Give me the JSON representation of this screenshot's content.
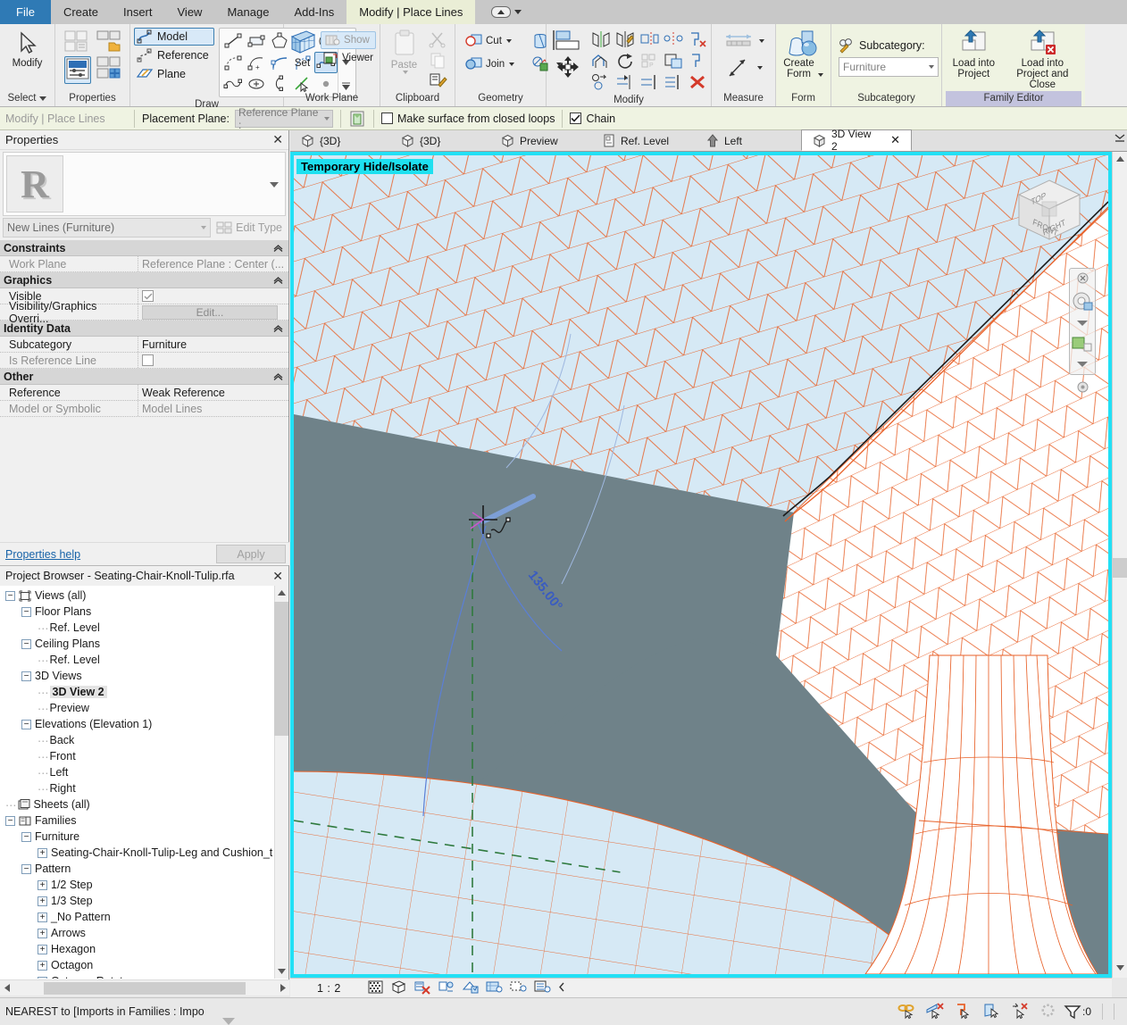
{
  "app": {
    "menu_tabs": [
      {
        "label": "File",
        "state": "file"
      },
      {
        "label": "Create",
        "state": "normal"
      },
      {
        "label": "Insert",
        "state": "normal"
      },
      {
        "label": "View",
        "state": "normal"
      },
      {
        "label": "Manage",
        "state": "normal"
      },
      {
        "label": "Add-Ins",
        "state": "normal"
      },
      {
        "label": "Modify | Place Lines",
        "state": "active"
      }
    ]
  },
  "ribbon": {
    "select_panel": {
      "title": "Select",
      "modify_label": "Modify"
    },
    "properties_panel": {
      "title": "Properties"
    },
    "draw_panel": {
      "title": "Draw",
      "model_label": "Model",
      "reference_label": "Reference",
      "plane_label": "Plane"
    },
    "workplane_panel": {
      "title": "Work Plane",
      "set_label": "Set",
      "show_label": "Show",
      "viewer_label": "Viewer"
    },
    "clipboard_panel": {
      "title": "Clipboard",
      "paste_label": "Paste"
    },
    "geometry_panel": {
      "title": "Geometry",
      "cut_label": "Cut",
      "join_label": "Join"
    },
    "modify_panel": {
      "title": "Modify"
    },
    "measure_panel": {
      "title": "Measure"
    },
    "form_panel": {
      "title": "Form",
      "create_form_label": "Create\nForm",
      "create_form_line1": "Create",
      "create_form_line2": "Form"
    },
    "subcategory_panel": {
      "title": "Subcategory",
      "label": "Subcategory:",
      "value": "Furniture"
    },
    "family_editor_panel": {
      "title": "Family Editor",
      "load_into_project_line1": "Load into",
      "load_into_project_line2": "Project",
      "load_close_line1": "Load into",
      "load_close_line2": "Project and Close"
    }
  },
  "options_bar": {
    "context": "Modify | Place Lines",
    "placement_plane_label": "Placement Plane:",
    "placement_plane_value": "Reference Plane :",
    "make_surface_label": "Make surface from closed loops",
    "make_surface_checked": false,
    "chain_label": "Chain",
    "chain_checked": true
  },
  "properties": {
    "title": "Properties",
    "thumbnail_letter": "R",
    "type_value": "New Lines (Furniture)",
    "edit_type_label": "Edit Type",
    "help_link": "Properties help",
    "apply_label": "Apply",
    "groups": [
      {
        "name": "Constraints",
        "rows": [
          {
            "name": "Work Plane",
            "value": "Reference Plane : Center (...",
            "kind": "text",
            "dim": true
          }
        ]
      },
      {
        "name": "Graphics",
        "rows": [
          {
            "name": "Visible",
            "value": "",
            "kind": "checkbox-checked",
            "dim": false
          },
          {
            "name": "Visibility/Graphics Overri...",
            "value": "Edit...",
            "kind": "button",
            "dim": false
          }
        ]
      },
      {
        "name": "Identity Data",
        "rows": [
          {
            "name": "Subcategory",
            "value": "Furniture",
            "kind": "text",
            "dim": false
          },
          {
            "name": "Is Reference Line",
            "value": "",
            "kind": "checkbox-empty",
            "dim": true
          }
        ]
      },
      {
        "name": "Other",
        "rows": [
          {
            "name": "Reference",
            "value": "Weak Reference",
            "kind": "text",
            "dim": false
          },
          {
            "name": "Model or Symbolic",
            "value": "Model Lines",
            "kind": "text",
            "dim": true
          }
        ]
      }
    ]
  },
  "browser": {
    "title": "Project Browser - Seating-Chair-Knoll-Tulip.rfa",
    "nodes": [
      {
        "label": "Views (all)",
        "depth": 0,
        "expander": "minus",
        "icon": "views-icon",
        "selected": false
      },
      {
        "label": "Floor Plans",
        "depth": 1,
        "expander": "minus",
        "icon": "",
        "selected": false
      },
      {
        "label": "Ref. Level",
        "depth": 2,
        "expander": "none",
        "icon": "",
        "selected": false
      },
      {
        "label": "Ceiling Plans",
        "depth": 1,
        "expander": "minus",
        "icon": "",
        "selected": false
      },
      {
        "label": "Ref. Level",
        "depth": 2,
        "expander": "none",
        "icon": "",
        "selected": false
      },
      {
        "label": "3D Views",
        "depth": 1,
        "expander": "minus",
        "icon": "",
        "selected": false
      },
      {
        "label": "3D View 2",
        "depth": 2,
        "expander": "none",
        "icon": "",
        "selected": true
      },
      {
        "label": "Preview",
        "depth": 2,
        "expander": "none",
        "icon": "",
        "selected": false
      },
      {
        "label": "Elevations (Elevation 1)",
        "depth": 1,
        "expander": "minus",
        "icon": "",
        "selected": false
      },
      {
        "label": "Back",
        "depth": 2,
        "expander": "none",
        "icon": "",
        "selected": false
      },
      {
        "label": "Front",
        "depth": 2,
        "expander": "none",
        "icon": "",
        "selected": false
      },
      {
        "label": "Left",
        "depth": 2,
        "expander": "none",
        "icon": "",
        "selected": false
      },
      {
        "label": "Right",
        "depth": 2,
        "expander": "none",
        "icon": "",
        "selected": false
      },
      {
        "label": "Sheets (all)",
        "depth": 0,
        "expander": "none",
        "icon": "sheets-icon",
        "selected": false
      },
      {
        "label": "Families",
        "depth": 0,
        "expander": "minus",
        "icon": "families-icon",
        "selected": false
      },
      {
        "label": "Furniture",
        "depth": 1,
        "expander": "minus",
        "icon": "",
        "selected": false
      },
      {
        "label": "Seating-Chair-Knoll-Tulip-Leg and Cushion_t",
        "depth": 2,
        "expander": "plus",
        "icon": "",
        "selected": false
      },
      {
        "label": "Pattern",
        "depth": 1,
        "expander": "minus",
        "icon": "",
        "selected": false
      },
      {
        "label": "1/2 Step",
        "depth": 2,
        "expander": "plus",
        "icon": "",
        "selected": false
      },
      {
        "label": "1/3 Step",
        "depth": 2,
        "expander": "plus",
        "icon": "",
        "selected": false
      },
      {
        "label": "_No Pattern",
        "depth": 2,
        "expander": "plus",
        "icon": "",
        "selected": false
      },
      {
        "label": "Arrows",
        "depth": 2,
        "expander": "plus",
        "icon": "",
        "selected": false
      },
      {
        "label": "Hexagon",
        "depth": 2,
        "expander": "plus",
        "icon": "",
        "selected": false
      },
      {
        "label": "Octagon",
        "depth": 2,
        "expander": "plus",
        "icon": "",
        "selected": false
      },
      {
        "label": "Octagon Rotate",
        "depth": 2,
        "expander": "plus",
        "icon": "",
        "selected": false
      }
    ]
  },
  "view_tabs": [
    {
      "label": "{3D}",
      "icon": "cube-icon",
      "active": false
    },
    {
      "label": "{3D}",
      "icon": "cube-icon",
      "active": false
    },
    {
      "label": "Preview",
      "icon": "cube-icon",
      "active": false
    },
    {
      "label": "Ref. Level",
      "icon": "plan-icon",
      "active": false
    },
    {
      "label": "Left",
      "icon": "elevation-icon",
      "active": false
    },
    {
      "label": "3D View 2",
      "icon": "cube-icon",
      "active": true
    }
  ],
  "canvas": {
    "banner": "Temporary Hide/Isolate",
    "angle_dimension": "135.00°",
    "viewcube": {
      "top": "TOP",
      "front": "FRONT",
      "right": "RIGHT"
    },
    "colors": {
      "background": "#6f8289",
      "edge": "#e8622a",
      "highlight_border": "#22e0f5",
      "face_light": "#d6e9f5",
      "face_white": "#ffffff",
      "dimension": "#4a6fd0",
      "refplane": "#2f7a3e"
    }
  },
  "view_control_bar": {
    "scale": "1 : 2",
    "icons": [
      "detail-level-icon",
      "visual-style-icon",
      "sun-path-icon",
      "shadows-icon",
      "render-icon",
      "crop-view-icon",
      "crop-region-icon",
      "hide-isolate-icon",
      "reveal-icon",
      "expand-icon"
    ]
  },
  "status_bar": {
    "message": "NEAREST  to [Imports in Families : Impo",
    "filter_count": ":0",
    "icons": [
      "chain-select-icon",
      "underlay-select-icon",
      "pinned-select-icon",
      "face-select-icon",
      "drag-select-icon",
      "worksets-icon",
      "filter-icon"
    ]
  }
}
